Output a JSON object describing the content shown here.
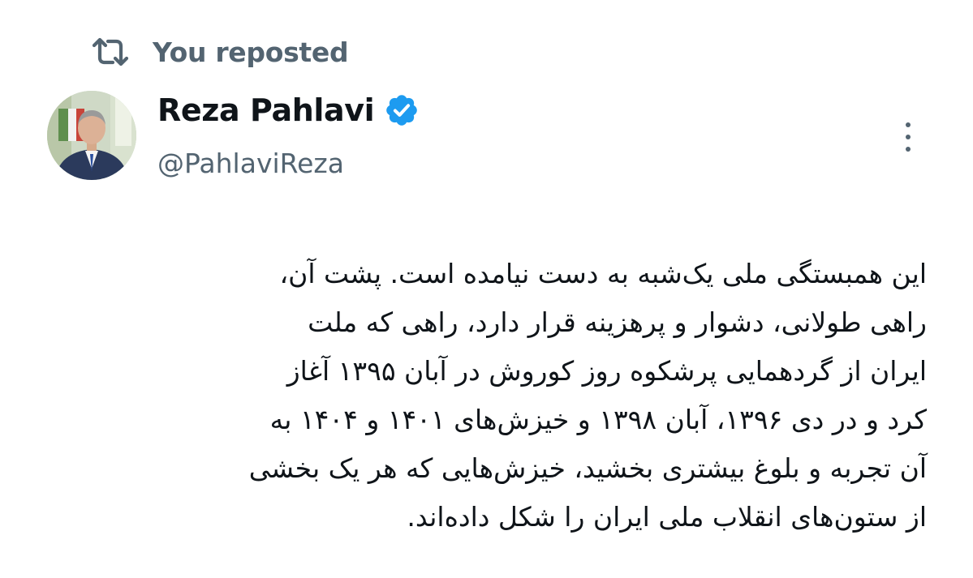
{
  "repost": {
    "icon": "repost-icon",
    "label": "You reposted"
  },
  "author": {
    "display_name": "Reza Pahlavi",
    "handle": "@PahlaviReza",
    "verified": true,
    "verified_color": "#1d9bf0",
    "avatar_icon": "profile-photo"
  },
  "menu": {
    "icon": "more-vertical-icon"
  },
  "tweet": {
    "text": "این همبستگی ملی یک‌شبه به دست نیامده است. پشت آن، راهی طولانی، دشوار و پرهزینه قرار دارد، راهی که ملت ایران از گردهمایی پرشکوه روز کوروش در آبان ۱۳۹۵ آغاز کرد و در دی ۱۳۹۶، آبان ۱۳۹۸ و خیزش‌های ۱۴۰۱ و ۱۴۰۴ به آن تجربه و بلوغ بیشتری بخشید، خیزش‌هایی که هر یک بخشی از ستون‌های انقلاب ملی ایران را شکل داده‌اند."
  },
  "colors": {
    "text_primary": "#0f1419",
    "text_secondary": "#536471",
    "background": "#ffffff"
  }
}
